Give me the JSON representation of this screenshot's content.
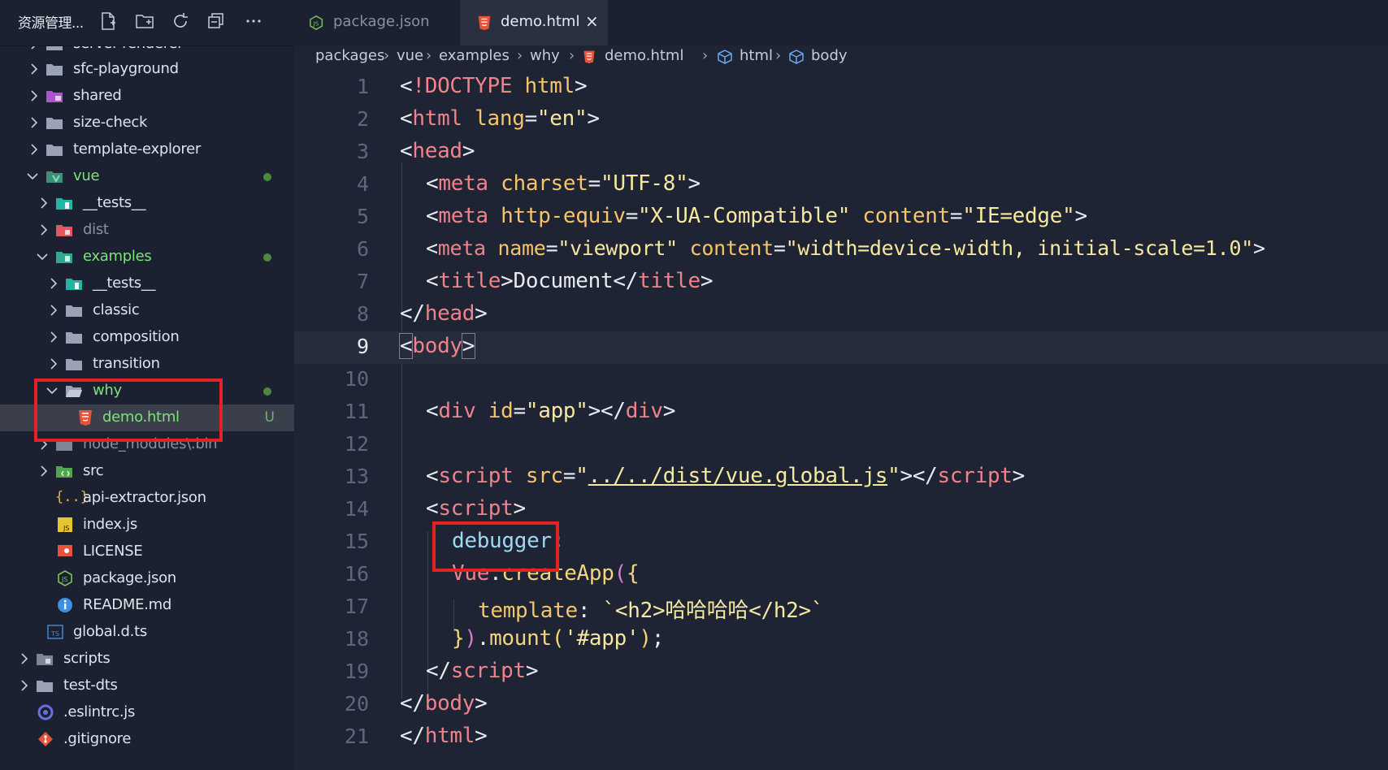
{
  "sidebar": {
    "title": "资源管理...",
    "actions": [
      "new-file-icon",
      "new-folder-icon",
      "refresh-icon",
      "collapse-all-icon",
      "more-icon"
    ],
    "items": [
      {
        "label": "server-renderer",
        "icon": "folder"
      },
      {
        "label": "sfc-playground",
        "icon": "folder"
      },
      {
        "label": "shared",
        "icon": "folder-purple"
      },
      {
        "label": "size-check",
        "icon": "folder"
      },
      {
        "label": "template-explorer",
        "icon": "folder"
      },
      {
        "label": "vue",
        "icon": "folder-vue"
      },
      {
        "label": "__tests__",
        "icon": "folder-test"
      },
      {
        "label": "dist",
        "icon": "folder-dist"
      },
      {
        "label": "examples",
        "icon": "folder-examples"
      },
      {
        "label": "__tests__",
        "icon": "folder-test"
      },
      {
        "label": "classic",
        "icon": "folder"
      },
      {
        "label": "composition",
        "icon": "folder"
      },
      {
        "label": "transition",
        "icon": "folder"
      },
      {
        "label": "why",
        "icon": "folder-open"
      },
      {
        "label": "demo.html",
        "icon": "html-file",
        "badge": "U"
      },
      {
        "label": "node_modules\\.bin",
        "icon": "folder"
      },
      {
        "label": "src",
        "icon": "folder-src"
      },
      {
        "label": "api-extractor.json",
        "icon": "json-file"
      },
      {
        "label": "index.js",
        "icon": "js-file"
      },
      {
        "label": "LICENSE",
        "icon": "license-file"
      },
      {
        "label": "package.json",
        "icon": "node-file"
      },
      {
        "label": "README.md",
        "icon": "info-file"
      },
      {
        "label": "global.d.ts",
        "icon": "ts-file"
      },
      {
        "label": "scripts",
        "icon": "folder-scripts"
      },
      {
        "label": "test-dts",
        "icon": "folder"
      },
      {
        "label": ".eslintrc.js",
        "icon": "eslint-file"
      },
      {
        "label": ".gitignore",
        "icon": "git-file"
      }
    ]
  },
  "tabs": [
    {
      "label": "package.json",
      "icon": "node-icon",
      "active": false
    },
    {
      "label": "demo.html",
      "icon": "html-icon",
      "active": true,
      "close": "×"
    }
  ],
  "breadcrumb": [
    "packages",
    "vue",
    "examples",
    "why",
    "demo.html",
    "html",
    "body"
  ],
  "code": {
    "line_numbers": [
      "1",
      "2",
      "3",
      "4",
      "5",
      "6",
      "7",
      "8",
      "9",
      "10",
      "11",
      "12",
      "13",
      "14",
      "15",
      "16",
      "17",
      "18",
      "19",
      "20",
      "21"
    ],
    "active_line": "9"
  },
  "colors": {
    "highlight_box": "#e52222",
    "editor_bg": "#1e2433",
    "sidebar_bg": "#1b2130"
  }
}
